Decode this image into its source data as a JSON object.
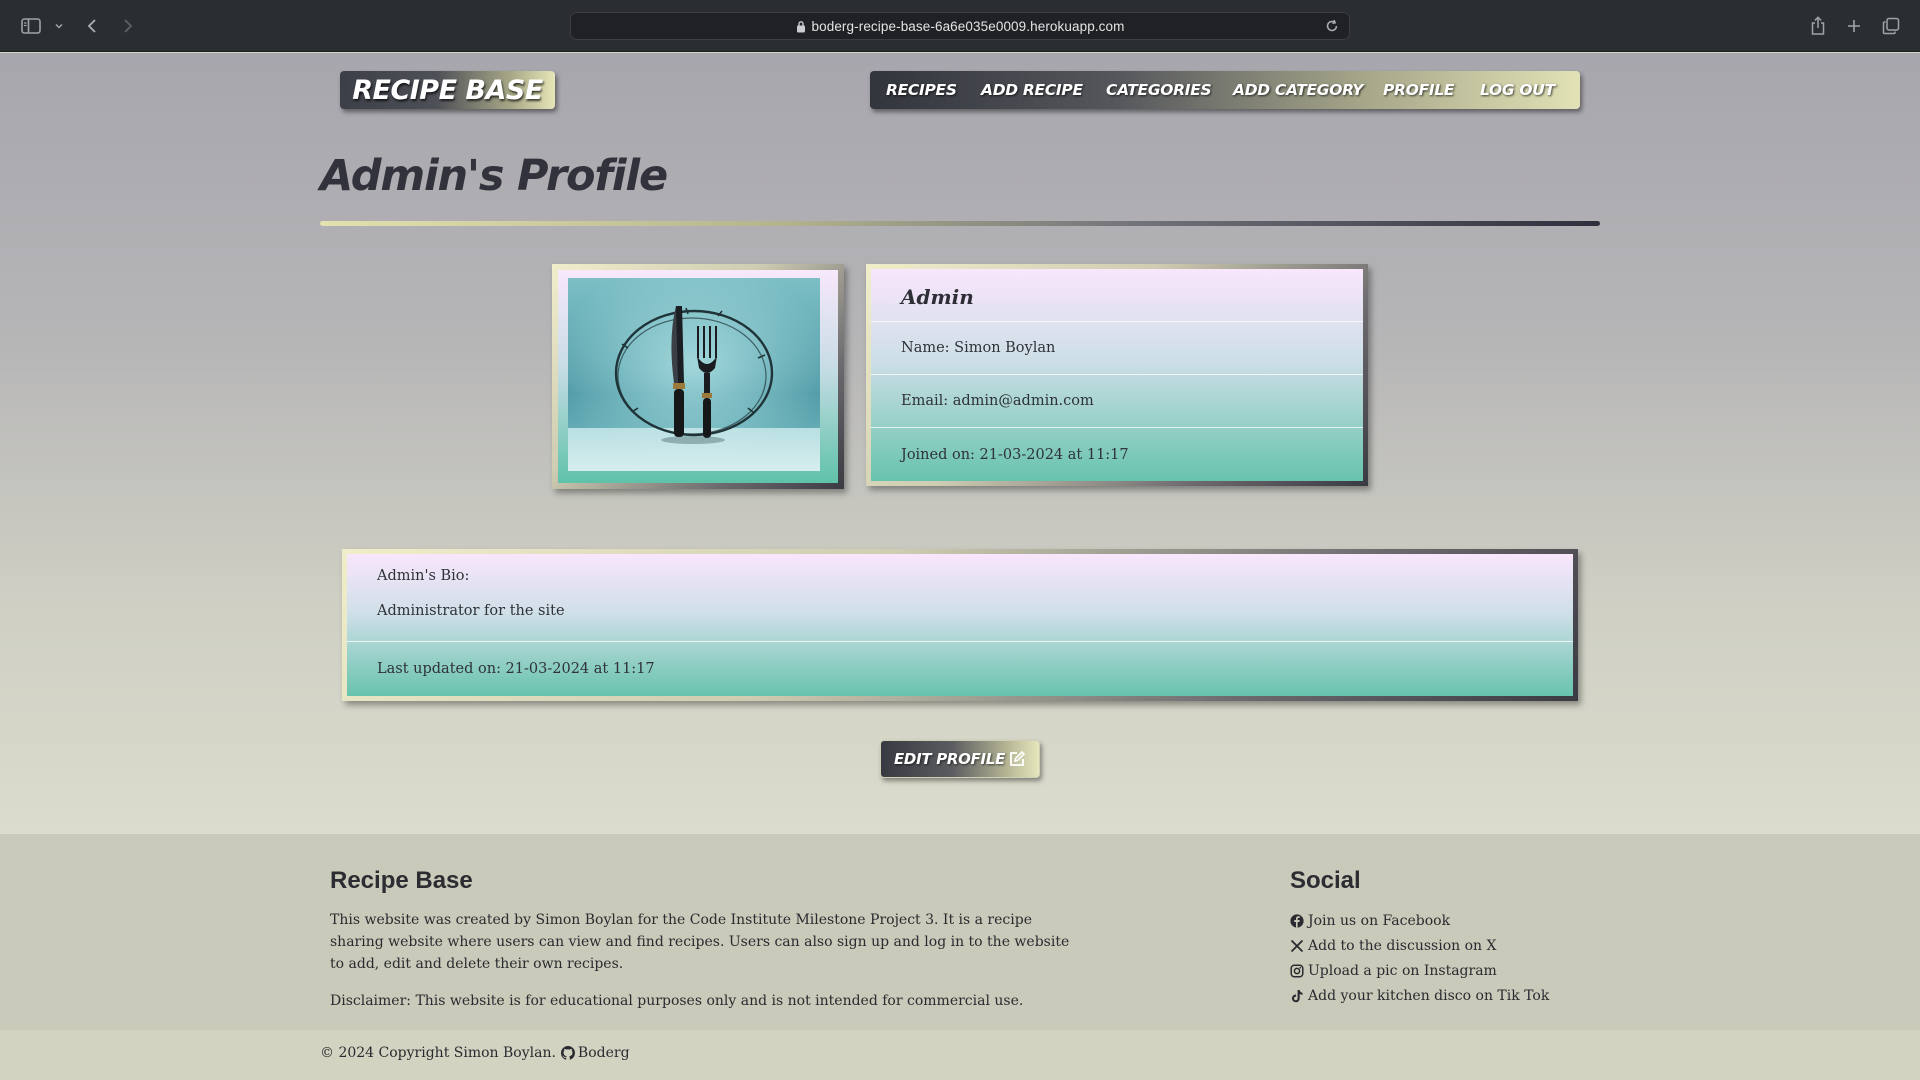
{
  "browser": {
    "url": "boderg-recipe-base-6a6e035e0009.herokuapp.com"
  },
  "header": {
    "logo": "RECIPE BASE",
    "nav": [
      "RECIPES",
      "ADD RECIPE",
      "CATEGORIES",
      "ADD CATEGORY",
      "PROFILE",
      "LOG OUT"
    ]
  },
  "main": {
    "title": "Admin's Profile",
    "profile": {
      "username": "Admin",
      "name": "Name: Simon Boylan",
      "email": "Email: admin@admin.com",
      "joined": "Joined on: 21-03-2024 at 11:17"
    },
    "bio": {
      "heading": "Admin's Bio:",
      "text": "Administrator for the site",
      "updated": "Last updated on: 21-03-2024 at 11:17"
    },
    "edit_button": "EDIT PROFILE"
  },
  "footer": {
    "about": {
      "heading": "Recipe Base",
      "paragraph1": "This website was created by Simon Boylan for the Code Institute Milestone Project 3. It is a recipe sharing website where users can view and find recipes. Users can also sign up and log in to the website to add, edit and delete their own recipes.",
      "paragraph2": "Disclaimer: This website is for educational purposes only and is not intended for commercial use."
    },
    "social": {
      "heading": "Social",
      "links": [
        {
          "icon": "facebook-icon",
          "label": "Join us on Facebook"
        },
        {
          "icon": "x-icon",
          "label": "Add to the discussion on X"
        },
        {
          "icon": "instagram-icon",
          "label": "Upload a pic on Instagram"
        },
        {
          "icon": "tiktok-icon",
          "label": "Add your kitchen disco on Tik Tok"
        }
      ]
    },
    "copyright": "© 2024 Copyright Simon Boylan.",
    "github": "Boderg"
  },
  "colors": {
    "chrome": "#2b2e31",
    "nav_dark": "#33353d",
    "nav_light": "#e2e2b6",
    "card_top": "#f9e6fc",
    "card_bottom": "#67c3ad",
    "footer": "#cacaba"
  }
}
